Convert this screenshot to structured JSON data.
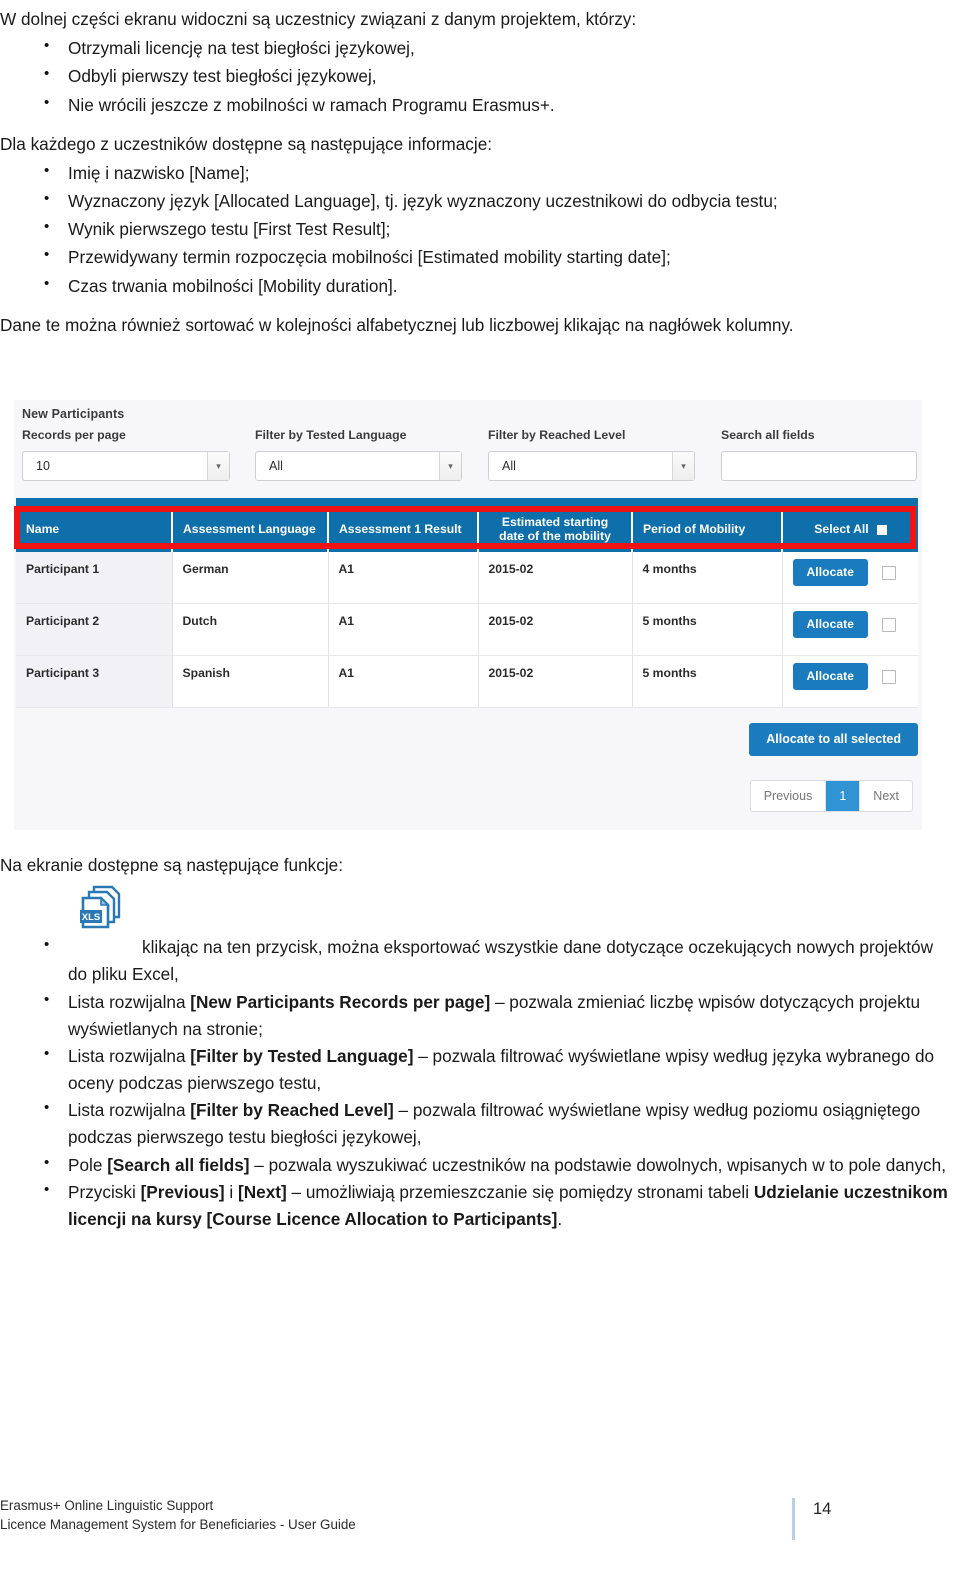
{
  "document": {
    "intro": "W dolnej części ekranu widoczni są uczestnicy związani z danym projektem, którzy:",
    "intro_bullets": [
      "Otrzymali licencję na test biegłości językowej,",
      "Odbyli pierwszy test biegłości językowej,",
      "Nie wrócili jeszcze z mobilności w ramach Programu Erasmus+."
    ],
    "info_heading": "Dla każdego z uczestników dostępne są następujące informacje:",
    "info_bullets": [
      "Imię i nazwisko [Name];",
      "Wyznaczony język [Allocated Language], tj. język wyznaczony uczestnikowi do odbycia testu;",
      "Wynik pierwszego testu [First Test Result];",
      "Przewidywany termin rozpoczęcia mobilności [Estimated mobility starting date];",
      "Czas trwania mobilności [Mobility duration]."
    ],
    "sort_note": "Dane te można również sortować w kolejności alfabetycznej lub liczbowej klikając na nagłówek kolumny.",
    "functions_heading": "Na ekranie dostępne są następujące funkcje:",
    "function_items": [
      {
        "prefix": "",
        "bold": "",
        "text": "klikając na ten przycisk, można eksportować wszystkie dane dotyczące oczekujących nowych projektów do pliku Excel,",
        "has_icon": true
      },
      {
        "prefix": "Lista rozwijalna ",
        "bold": "[New Participants Records per page]",
        "text": " – pozwala zmieniać liczbę wpisów dotyczących projektu wyświetlanych na stronie;",
        "has_icon": false
      },
      {
        "prefix": "Lista rozwijalna ",
        "bold": "[Filter by Tested Language]",
        "text": " – pozwala filtrować wyświetlane wpisy według języka wybranego do oceny podczas pierwszego testu,",
        "has_icon": false
      },
      {
        "prefix": "Lista rozwijalna ",
        "bold": "[Filter by Reached Level]",
        "text": " – pozwala filtrować wyświetlane wpisy według poziomu osiągniętego podczas pierwszego testu biegłości językowej,",
        "has_icon": false
      },
      {
        "prefix": "Pole ",
        "bold": "[Search all fields]",
        "text": " – pozwala wyszukiwać uczestników na podstawie dowolnych, wpisanych w to pole danych,",
        "has_icon": false
      }
    ],
    "last_item": {
      "p1": "Przyciski ",
      "b1": "[Previous]",
      "p2": " i ",
      "b2": "[Next]",
      "p3": " – umożliwiają przemieszczanie się pomiędzy stronami tabeli ",
      "b3": "Udzielanie uczestnikom licencji na kursy [Course Licence Allocation to Participants]",
      "p4": "."
    }
  },
  "footer": {
    "line1": "Erasmus+ Online Linguistic Support",
    "line2": "Licence Management System for Beneficiaries - User Guide",
    "page_number": "14"
  },
  "screenshot": {
    "title": "New Participants",
    "controls": [
      {
        "label": "Records per page",
        "type": "select",
        "value": "10"
      },
      {
        "label": "Filter by Tested Language",
        "type": "select",
        "value": "All"
      },
      {
        "label": "Filter by Reached Level",
        "type": "select",
        "value": "All"
      },
      {
        "label": "Search all fields",
        "type": "text",
        "value": "",
        "placeholder": ""
      }
    ],
    "table": {
      "headers": [
        "Name",
        "Assessment Language",
        "Assessment 1 Result",
        "Estimated starting date of the mobility",
        "Period of Mobility",
        "Select All"
      ],
      "rows": [
        {
          "name": "Participant 1",
          "language": "German",
          "result": "A1",
          "start_date": "2015-02",
          "period": "4 months",
          "action": "Allocate"
        },
        {
          "name": "Participant 2",
          "language": "Dutch",
          "result": "A1",
          "start_date": "2015-02",
          "period": "5 months",
          "action": "Allocate"
        },
        {
          "name": "Participant 3",
          "language": "Spanish",
          "result": "A1",
          "start_date": "2015-02",
          "period": "5 months",
          "action": "Allocate"
        }
      ]
    },
    "bulk_button": "Allocate to all selected",
    "pagination": {
      "previous": "Previous",
      "current": "1",
      "next": "Next"
    },
    "colors": {
      "header_blue": "#0f6fab",
      "button_blue": "#1a7cbf",
      "highlight_red": "#ef1313",
      "pager_active": "#2f93d4"
    }
  }
}
